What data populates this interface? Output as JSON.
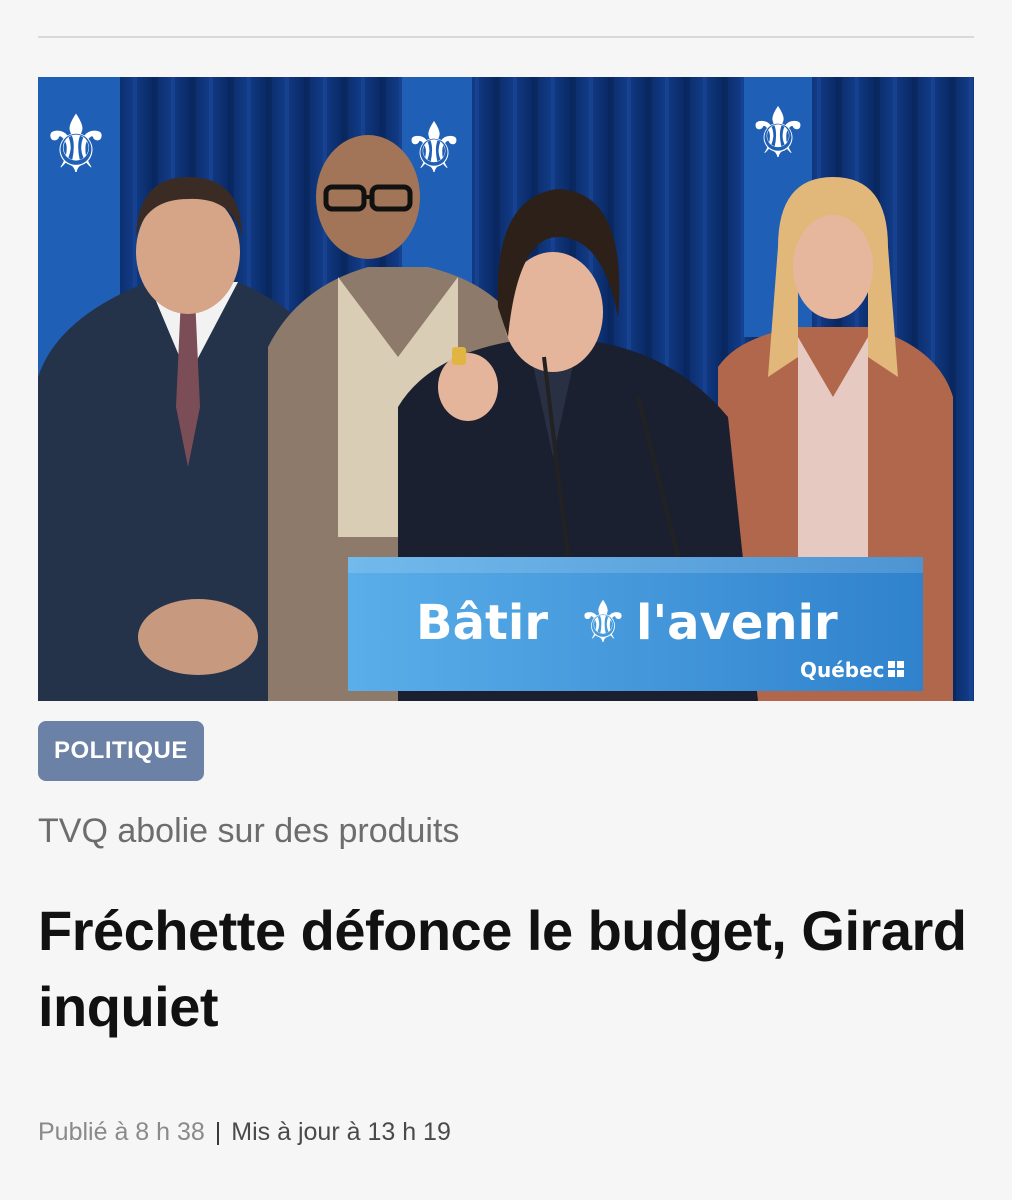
{
  "article": {
    "image": {
      "description": "",
      "podium_text": "Bâtir",
      "podium_text_2": "l'avenir",
      "podium_brand": "Québec"
    },
    "category": "POLITIQUE",
    "kicker": "TVQ abolie sur des produits",
    "headline": "Fréchette défonce le budget, Girard inquiet",
    "published": "Publié à 8 h 38",
    "separator": "|",
    "updated": "Mis à jour à 13 h 19"
  },
  "colors": {
    "background": "#f6f6f6",
    "category_badge": "#6b82a6",
    "headline": "#111111",
    "kicker": "#6d6d6d",
    "meta": "#8a8a8a",
    "flag_blue": "#1f5fb5",
    "curtain_blue": "#0b2f73",
    "podium_blue": "#3f95d8"
  }
}
